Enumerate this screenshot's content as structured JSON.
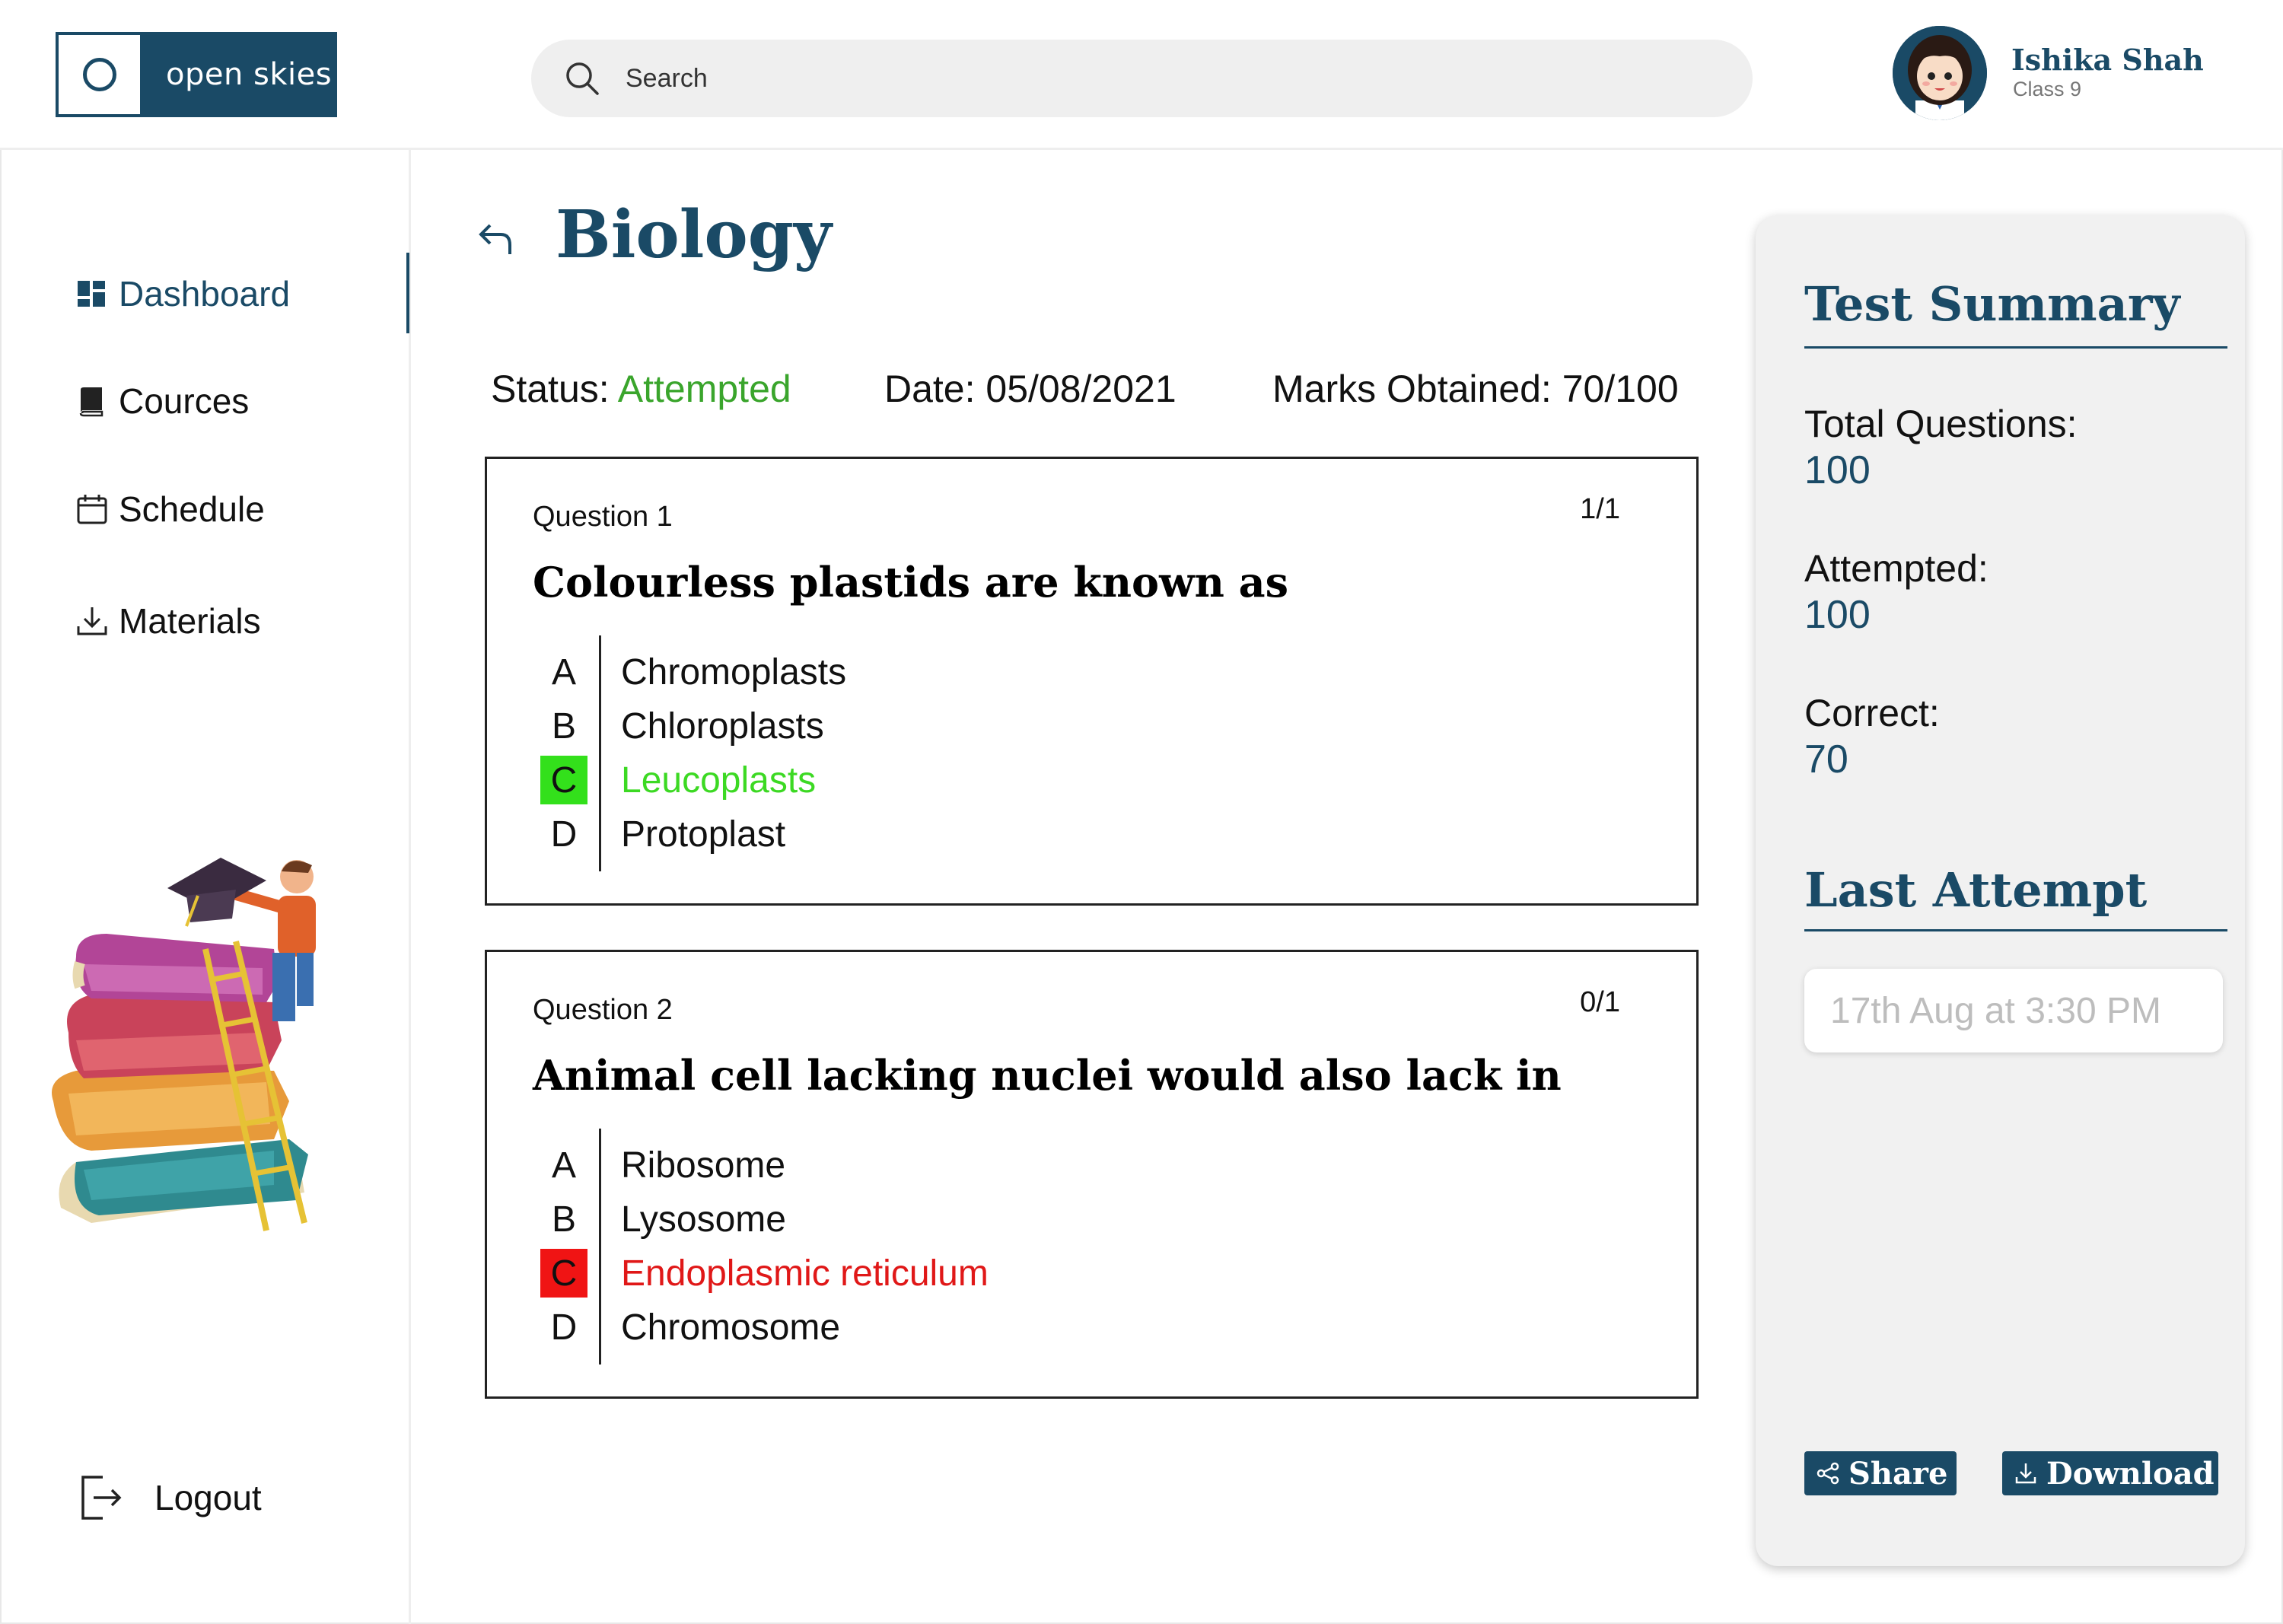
{
  "header": {
    "logo_text": "open skies",
    "search_placeholder": "Search",
    "user": {
      "name": "Ishika Shah",
      "class": "Class 9"
    }
  },
  "sidebar": {
    "items": [
      {
        "label": "Dashboard",
        "icon": "dashboard-icon",
        "active": true
      },
      {
        "label": "Cources",
        "icon": "book-icon",
        "active": false
      },
      {
        "label": "Schedule",
        "icon": "calendar-icon",
        "active": false
      },
      {
        "label": "Materials",
        "icon": "download-icon",
        "active": false
      }
    ],
    "logout_label": "Logout"
  },
  "main": {
    "title": "Biology",
    "status_label": "Status:",
    "status_value": "Attempted",
    "date_text": "Date: 05/08/2021",
    "marks_text": "Marks Obtained: 70/100",
    "questions": [
      {
        "label": "Question 1",
        "score": "1/1",
        "text": "Colourless plastids are known as",
        "options": [
          {
            "letter": "A",
            "text": "Chromoplasts",
            "state": "none"
          },
          {
            "letter": "B",
            "text": "Chloroplasts",
            "state": "none"
          },
          {
            "letter": "C",
            "text": "Leucoplasts",
            "state": "correct"
          },
          {
            "letter": "D",
            "text": "Protoplast",
            "state": "none"
          }
        ]
      },
      {
        "label": "Question 2",
        "score": "0/1",
        "text": "Animal cell lacking nuclei would also lack in",
        "options": [
          {
            "letter": "A",
            "text": "Ribosome",
            "state": "none"
          },
          {
            "letter": "B",
            "text": "Lysosome",
            "state": "none"
          },
          {
            "letter": "C",
            "text": "Endoplasmic reticulum",
            "state": "wrong"
          },
          {
            "letter": "D",
            "text": "Chromosome",
            "state": "none"
          }
        ]
      }
    ]
  },
  "summary": {
    "title": "Test Summary",
    "total_label": "Total Questions:",
    "total_value": "100",
    "attempted_label": "Attempted:",
    "attempted_value": "100",
    "correct_label": "Correct:",
    "correct_value": "70",
    "last_attempt_title": "Last Attempt",
    "last_attempt_value": "17th Aug at 3:30 PM",
    "share_label": "Share",
    "download_label": "Download"
  },
  "colors": {
    "brand": "#1a4a66",
    "correct": "#33e01b",
    "wrong": "#f01414",
    "status": "#3aa52c"
  }
}
